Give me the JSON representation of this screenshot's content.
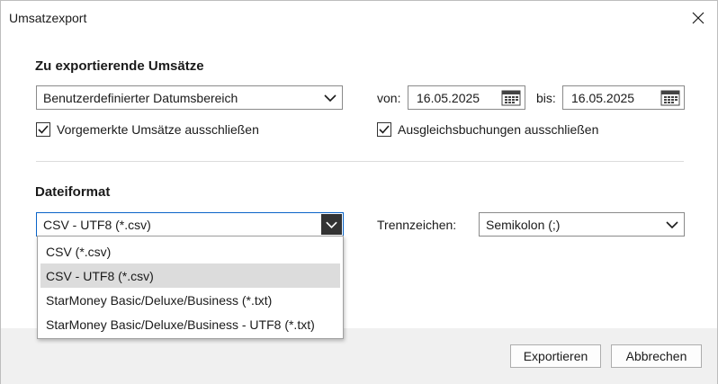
{
  "window": {
    "title": "Umsatzexport"
  },
  "section1": {
    "title": "Zu exportierende Umsätze",
    "range_select": {
      "value": "Benutzerdefinierter Datumsbereich"
    },
    "from_label": "von:",
    "from_date": "16.05.2025",
    "to_label": "bis:",
    "to_date": "16.05.2025",
    "exclude_pending": {
      "label": "Vorgemerkte Umsätze ausschließen",
      "checked": true
    },
    "exclude_balancing": {
      "label": "Ausgleichsbuchungen ausschließen",
      "checked": true
    }
  },
  "section2": {
    "title": "Dateiformat",
    "format_select": {
      "value": "CSV - UTF8 (*.csv)"
    },
    "separator_label": "Trennzeichen:",
    "separator_select": {
      "value": "Semikolon (;)"
    },
    "format_options": [
      {
        "label": "CSV (*.csv)"
      },
      {
        "label": "CSV - UTF8 (*.csv)"
      },
      {
        "label": "StarMoney Basic/Deluxe/Business (*.txt)"
      },
      {
        "label": "StarMoney Basic/Deluxe/Business - UTF8 (*.txt)"
      }
    ],
    "selected_option_index": 1
  },
  "footer": {
    "export_label": "Exportieren",
    "cancel_label": "Abbrechen"
  },
  "icons": {
    "close": "close-icon",
    "chevron": "chevron-down-icon",
    "calendar": "calendar-icon",
    "check": "checkmark-icon"
  }
}
